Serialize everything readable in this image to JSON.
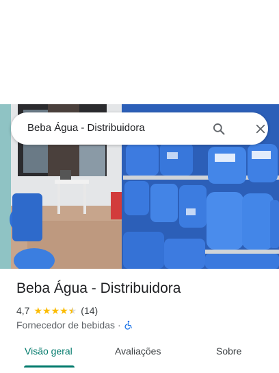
{
  "search": {
    "query": "Beba Água - Distribuidora",
    "search_icon": "search-icon",
    "close_icon": "close-icon"
  },
  "place": {
    "name": "Beba Água - Distribuidora",
    "rating": "4,7",
    "rating_stars": 4.7,
    "review_count": "(14)",
    "category": "Fornecedor de bebidas",
    "separator": "·",
    "accessibility_icon": "wheelchair-icon"
  },
  "tabs": [
    {
      "label": "Visão geral",
      "active": true
    },
    {
      "label": "Avaliações",
      "active": false
    },
    {
      "label": "Sobre",
      "active": false
    }
  ],
  "colors": {
    "accent": "#00796b",
    "star": "#fbbc04",
    "accessibility": "#1a73e8"
  }
}
